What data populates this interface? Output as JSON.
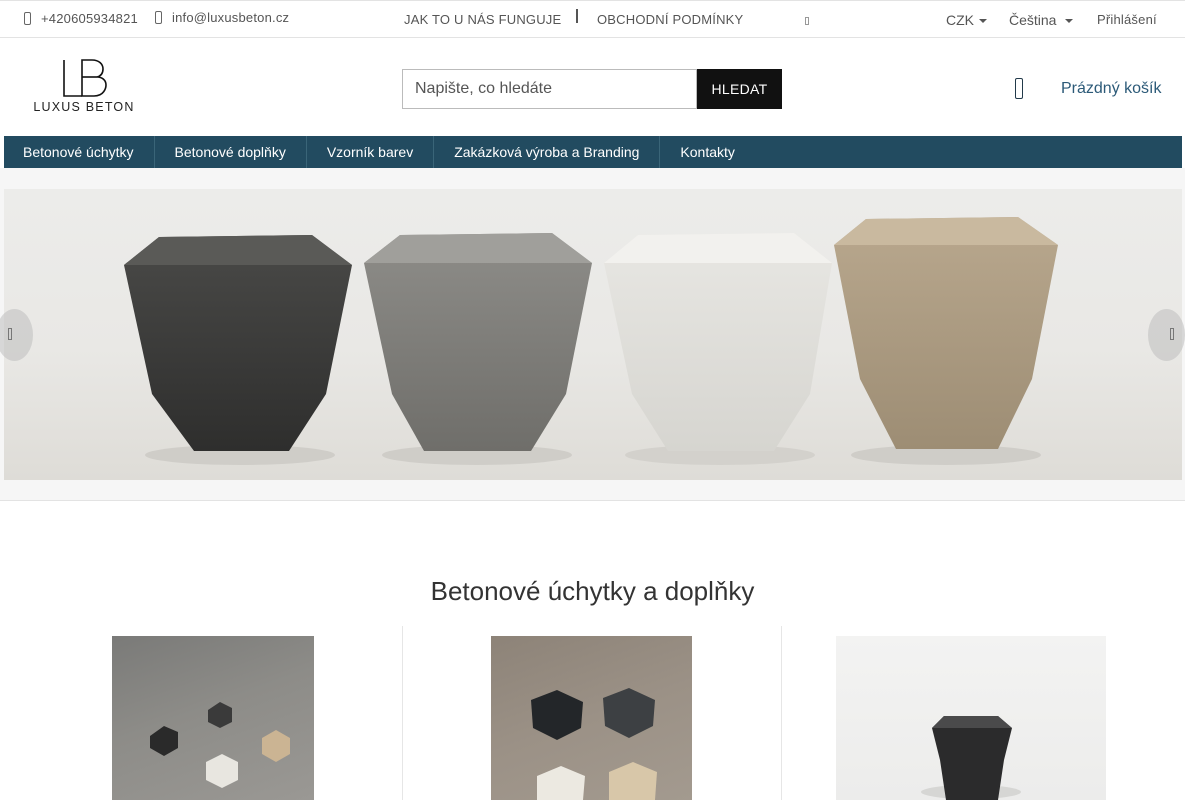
{
  "topbar": {
    "phone": "+420605934821",
    "email": "info@luxusbeton.cz",
    "how_it_works": "JAK TO U NÁS FUNGUJE",
    "terms": "OBCHODNÍ PODMÍNKY",
    "currency": "CZK",
    "language": "Čeština",
    "login": "Přihlášení"
  },
  "logo": {
    "text": "LUXUS BETON"
  },
  "search": {
    "placeholder": "Napište, co hledáte",
    "button": "HLEDAT"
  },
  "cart": {
    "label": "Prázdný košík"
  },
  "nav": {
    "items": [
      {
        "label": "Betonové úchytky"
      },
      {
        "label": "Betonové doplňky"
      },
      {
        "label": "Vzorník barev"
      },
      {
        "label": "Zakázková výroba a Branding"
      },
      {
        "label": "Kontakty"
      }
    ]
  },
  "section": {
    "title": "Betonové úchytky a doplňky"
  },
  "colors": {
    "nav_bg": "#224b60",
    "link": "#2c5a78",
    "button_bg": "#111111"
  }
}
